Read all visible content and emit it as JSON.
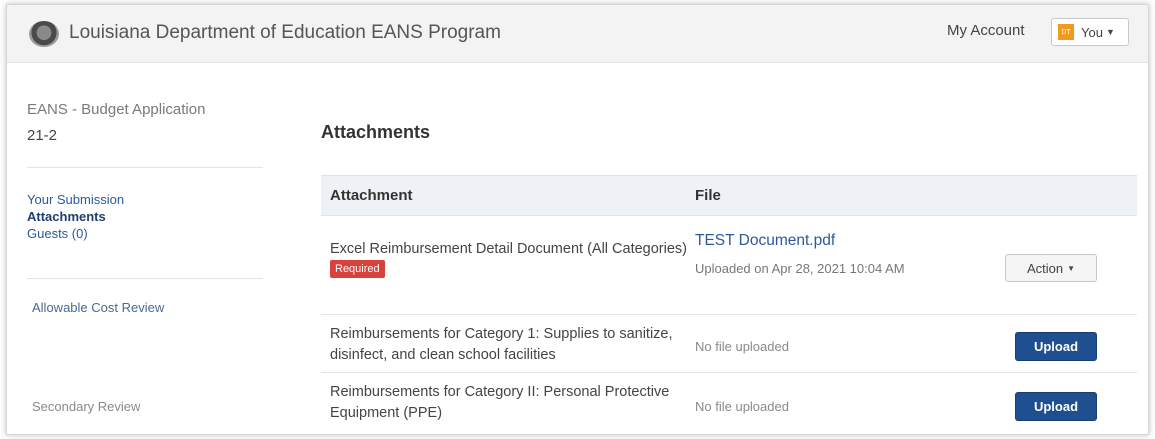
{
  "header": {
    "logo_icon": "louisiana-seal-icon",
    "title": "Louisiana Department of Education EANS Program",
    "my_account": "My Account",
    "user_label": "You",
    "user_avatar_text": "DT",
    "user_avatar_color": "#f39a1e"
  },
  "sidebar": {
    "app_name": "EANS - Budget Application",
    "app_id": "21-2",
    "nav": [
      {
        "label": "Your Submission",
        "active": false
      },
      {
        "label": "Attachments",
        "active": true
      },
      {
        "label": "Guests (0)",
        "active": false
      }
    ],
    "reviews": [
      {
        "label": "Allowable Cost Review"
      },
      {
        "label": "Secondary Review"
      }
    ]
  },
  "main": {
    "heading": "Attachments",
    "table": {
      "columns": [
        "Attachment",
        "File"
      ],
      "rows": [
        {
          "attachment": "Excel Reimbursement Detail Document (All Categories)",
          "required_badge": "Required",
          "file_name": "TEST Document.pdf",
          "uploaded": "Uploaded on Apr 28, 2021 10:04 AM",
          "action_label": "Action"
        },
        {
          "attachment": "Reimbursements for Category 1: Supplies to sanitize, disinfect, and clean school facilities",
          "file_status": "No file uploaded",
          "action_label": "Upload"
        },
        {
          "attachment": "Reimbursements for Category II: Personal Protective Equipment (PPE)",
          "file_status": "No file uploaded",
          "action_label": "Upload"
        }
      ]
    }
  },
  "colors": {
    "link": "#2a5a9e",
    "primary_button": "#1f4f91",
    "required": "#d9413c"
  }
}
